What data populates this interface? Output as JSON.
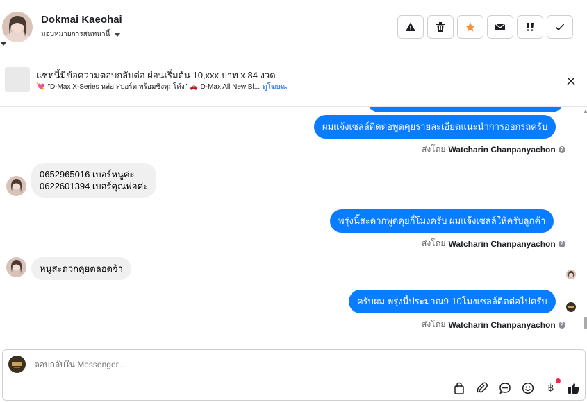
{
  "header": {
    "contact_name": "Dokmai Kaeohai",
    "assign_label": "มอบหมายการสนทนานี้",
    "actions": [
      {
        "name": "spam-button",
        "icon": "warning-icon"
      },
      {
        "name": "delete-button",
        "icon": "trash-icon"
      },
      {
        "name": "star-button",
        "icon": "star-icon",
        "color": "#f7923a"
      },
      {
        "name": "unread-button",
        "icon": "envelope-icon"
      },
      {
        "name": "follow-up-button",
        "icon": "flag-icon"
      },
      {
        "name": "done-button",
        "icon": "check-icon"
      }
    ]
  },
  "ad": {
    "title": "แชทนี้มีข้อความตอบกลับต่อ ผ่อนเริ่มต้น 10,xxx บาท x 84 งวด",
    "subtitle": "\"D-Max X-Series หล่อ สปอร์ต พร้อมซิ่งทุกโค้ง\"",
    "subtitle2": "D-Max All New Bl...",
    "link": "ดูโฆษณา"
  },
  "messages": {
    "out1_partial": "",
    "out2": "ผมแจ้งเซลล์ติดต่อพูดคุยรายละเอียดแนะนำการออกรถครับ",
    "sentby_prefix": "ส่งโดย",
    "sender": "Watcharin Chanpanyachon",
    "in1_line1": "0652965016 เบอร์หนูค่ะ",
    "in1_line2": "0622601394 เบอร์คุณพ่อค่ะ",
    "out3": "พรุ่งนี้สะดวกพูดคุยกี่โมงครับ ผมแจ้งเซลล์ให้ครับลูกค้า",
    "in2": "หนูสะดวกคุยตลอดจ้า",
    "out4": "ครับผม พรุ่งนี้ประมาณ9-10โมงเซลล์ติดต่อไปครับ"
  },
  "composer": {
    "placeholder": "ตอบกลับใน Messenger..."
  },
  "colors": {
    "accent": "#0a7cff",
    "incoming_bubble": "#f0f0f0",
    "star": "#f7923a"
  }
}
